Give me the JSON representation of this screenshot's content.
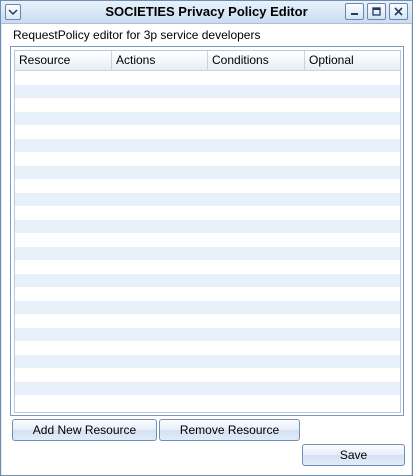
{
  "window": {
    "title": "SOCIETIES Privacy Policy Editor",
    "sysmenu_icon": "chevron-down-icon",
    "minimize_icon": "minimize-icon",
    "maximize_icon": "maximize-icon",
    "close_icon": "close-icon"
  },
  "main": {
    "subtitle": "RequestPolicy editor for 3p service developers",
    "table": {
      "columns": [
        "Resource",
        "Actions",
        "Conditions",
        "Optional"
      ],
      "rows": []
    }
  },
  "buttons": {
    "add_label": "Add New Resource",
    "remove_label": "Remove Resource",
    "save_label": "Save"
  },
  "colors": {
    "titlebar": "#c9dcf1",
    "row_stripe": "#e8f0fa",
    "border": "#7a9cc0"
  }
}
